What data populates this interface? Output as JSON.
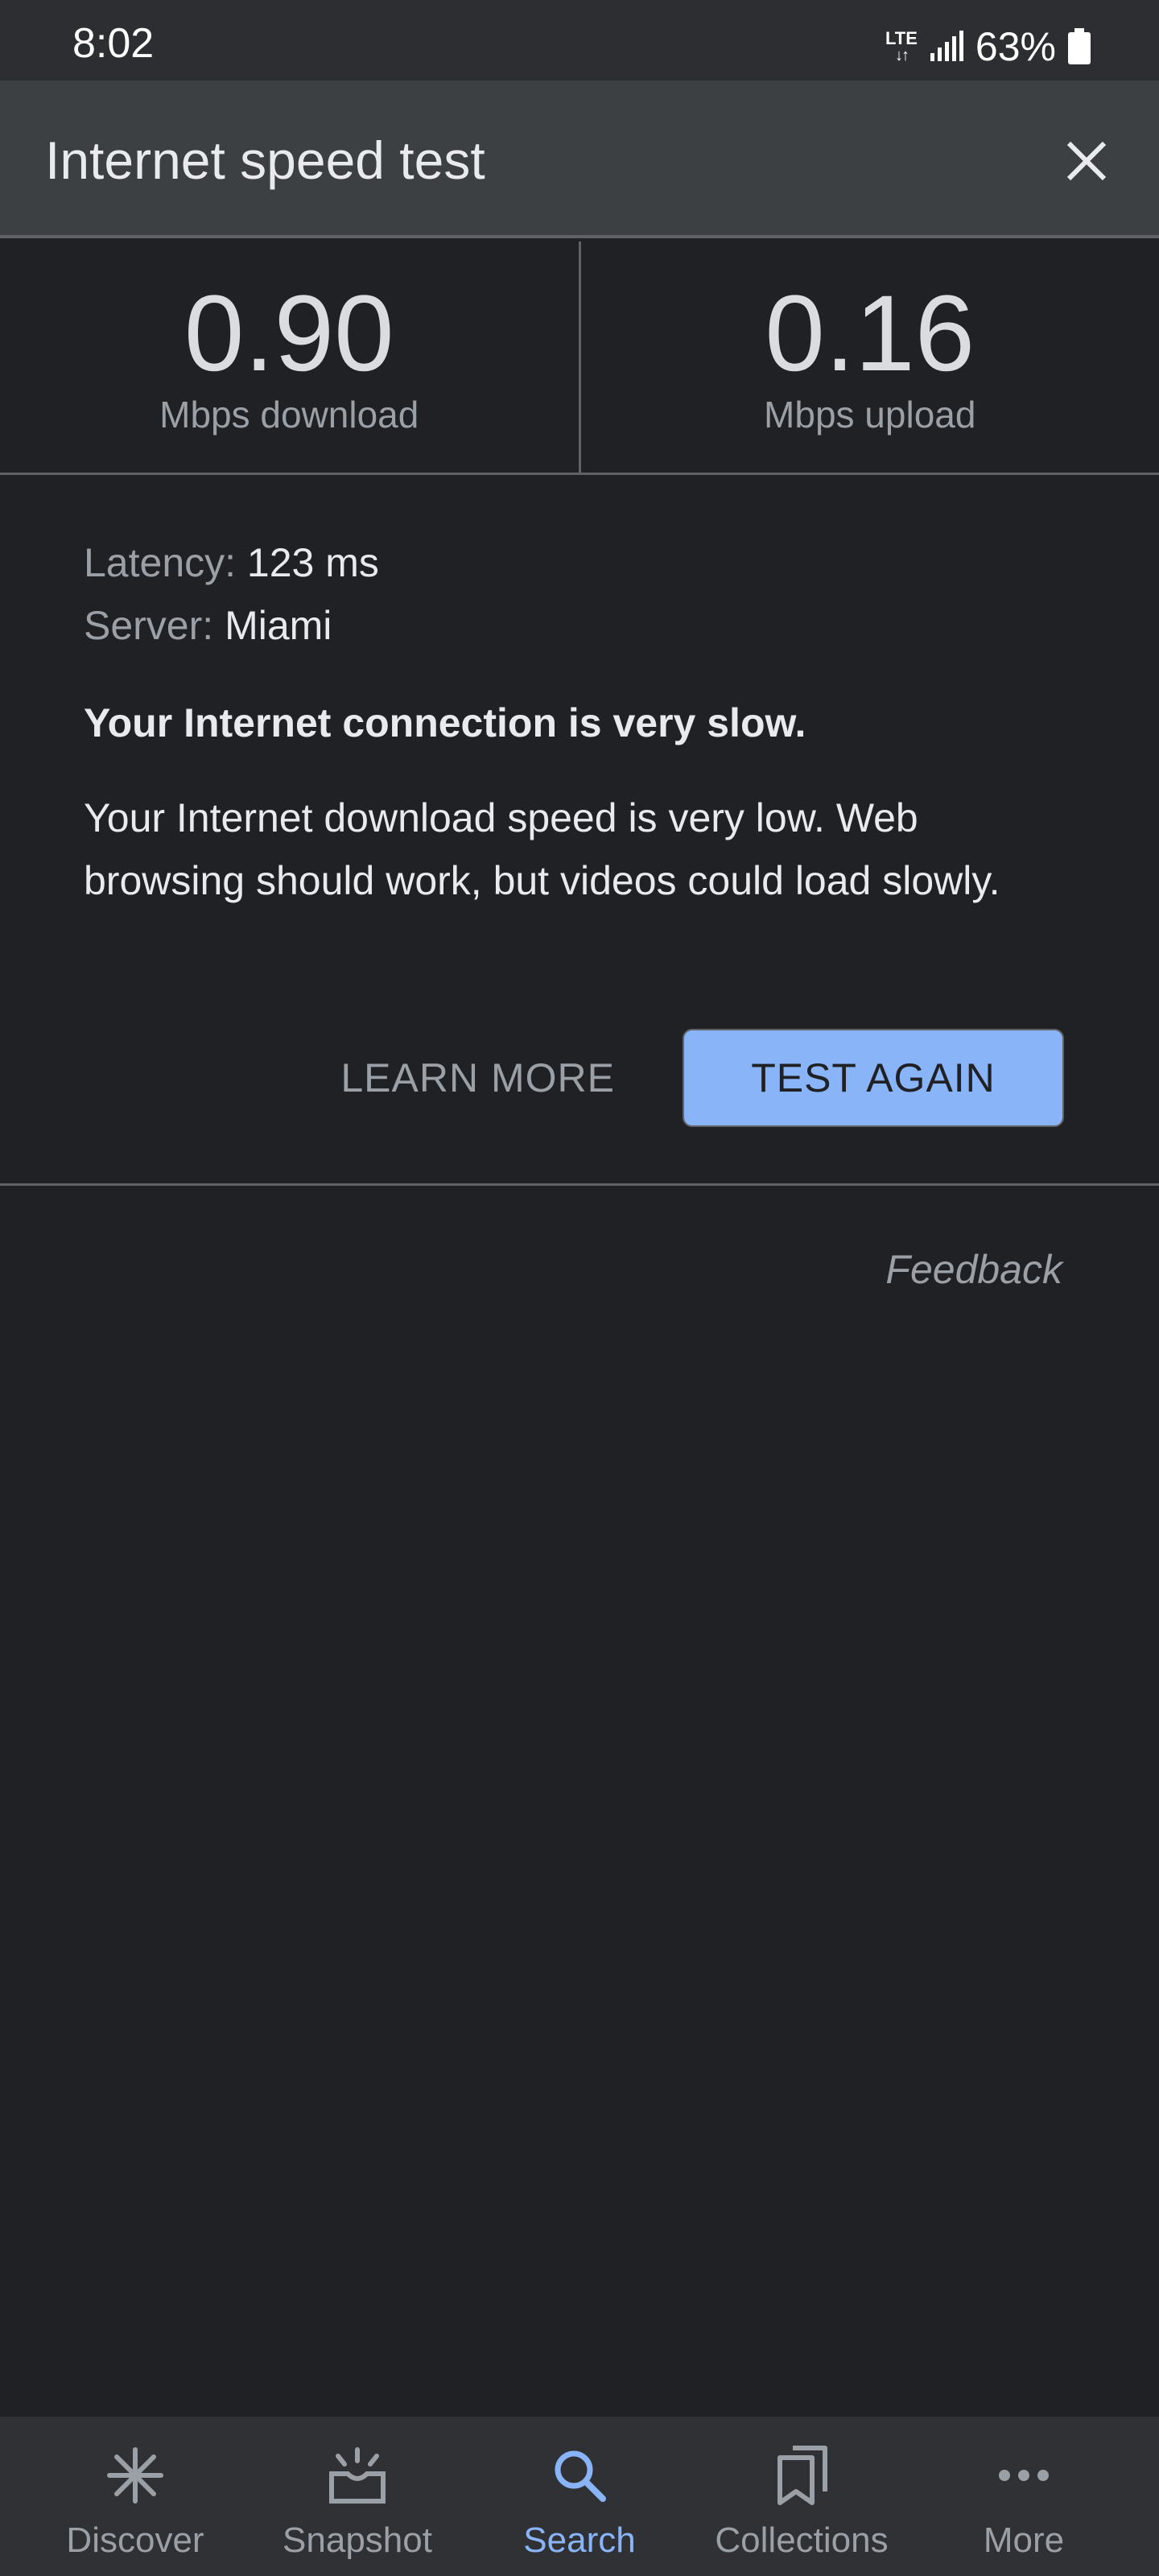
{
  "status_bar": {
    "time": "8:02",
    "network": "LTE",
    "battery": "63%"
  },
  "header": {
    "title": "Internet speed test",
    "close_icon": "close-icon"
  },
  "results": {
    "download": {
      "value": "0.90",
      "label": "Mbps download"
    },
    "upload": {
      "value": "0.16",
      "label": "Mbps upload"
    }
  },
  "details": {
    "latency_label": "Latency:",
    "latency_value": "123 ms",
    "server_label": "Server:",
    "server_value": "Miami",
    "verdict": "Your Internet connection is very slow.",
    "explanation": "Your Internet download speed is very low. Web browsing should work, but videos could load slowly."
  },
  "actions": {
    "learn_more": "LEARN MORE",
    "test_again": "TEST AGAIN"
  },
  "feedback": "Feedback",
  "bottom_nav": {
    "items": [
      {
        "label": "Discover",
        "icon": "asterisk-icon",
        "active": false
      },
      {
        "label": "Snapshot",
        "icon": "snapshot-icon",
        "active": false
      },
      {
        "label": "Search",
        "icon": "search-icon",
        "active": true
      },
      {
        "label": "Collections",
        "icon": "bookmarks-icon",
        "active": false
      },
      {
        "label": "More",
        "icon": "more-dots-icon",
        "active": false
      }
    ]
  },
  "colors": {
    "background": "#202124",
    "header": "#3c4043",
    "accent": "#8ab4f8",
    "muted_text": "#9aa0a6"
  }
}
